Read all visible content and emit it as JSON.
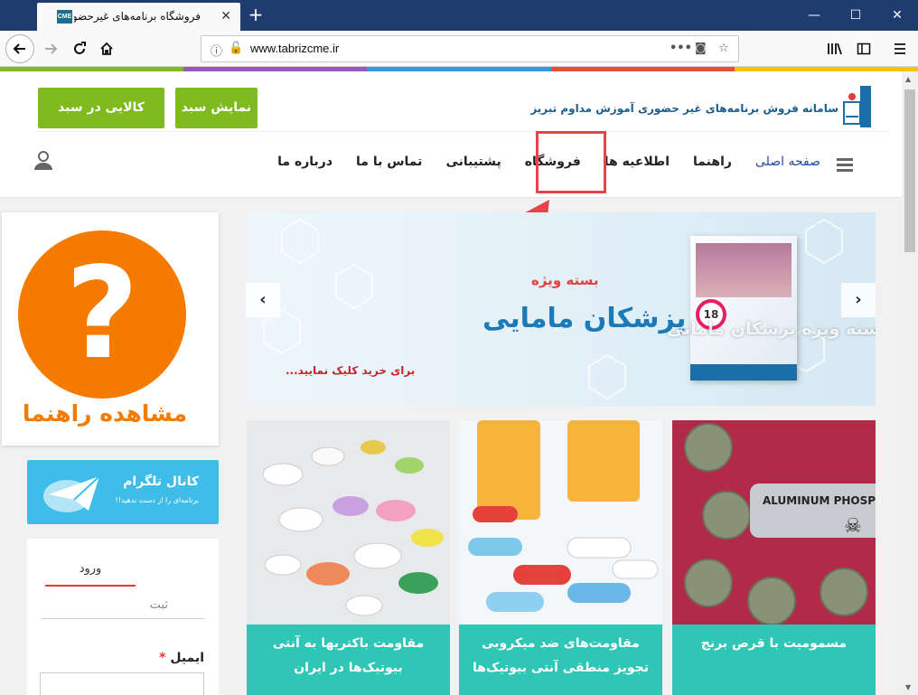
{
  "browser": {
    "tab_title": "فروشگاه برنامه‌های غیرحضوری مر",
    "tab_favicon": "CME",
    "url": "www.tabrizcme.ir",
    "close_glyph": "✕",
    "newtab_glyph": "+"
  },
  "header": {
    "site_title": "سامانه فروش برنامه‌های غیر حضوری آموزش مداوم تبریز",
    "show_cart": "نمایش سبد",
    "empty_cart": "کالایی در سبد نیست"
  },
  "menu": {
    "items": [
      "صفحه اصلی",
      "راهنما",
      "اطلاعیه ها",
      "فروشگاه",
      "پشتیبانی",
      "تماس با ما",
      "درباره ما"
    ]
  },
  "slider": {
    "tag": "بسته ویژه",
    "title": "پزشکان مامایی",
    "cta": "برای خرید کلیک نمایید...",
    "ghost_caption": "بسته ویژه پزشکان مامایی",
    "box_badge": "18"
  },
  "products": [
    {
      "caption": "مقاومت باکتریها به آنتی بیوتیک‌ها در ایران"
    },
    {
      "caption": "مقاومت‌های ضد میکروبی تجویز منطقی آنتی بیوتیک‌ها"
    },
    {
      "caption": "مسمومیت با قرص برنج"
    }
  ],
  "product_label": "ALUMINUM PHOSPHI",
  "help": {
    "symbol": "?",
    "label": "مشاهده راهنما"
  },
  "telegram": {
    "title": "کانال تلگرام",
    "subtitle": "برنامه‌ای را از دست ندهید!!"
  },
  "login": {
    "tab_login": "ورود",
    "tab_register": "ثبت",
    "email_label": "ایمیل",
    "required_mark": "*"
  },
  "colors": {
    "accent_green": "#7fba1e",
    "accent_teal": "#2fc6b6",
    "accent_orange": "#f47b00",
    "highlight_red": "#e8434a"
  }
}
